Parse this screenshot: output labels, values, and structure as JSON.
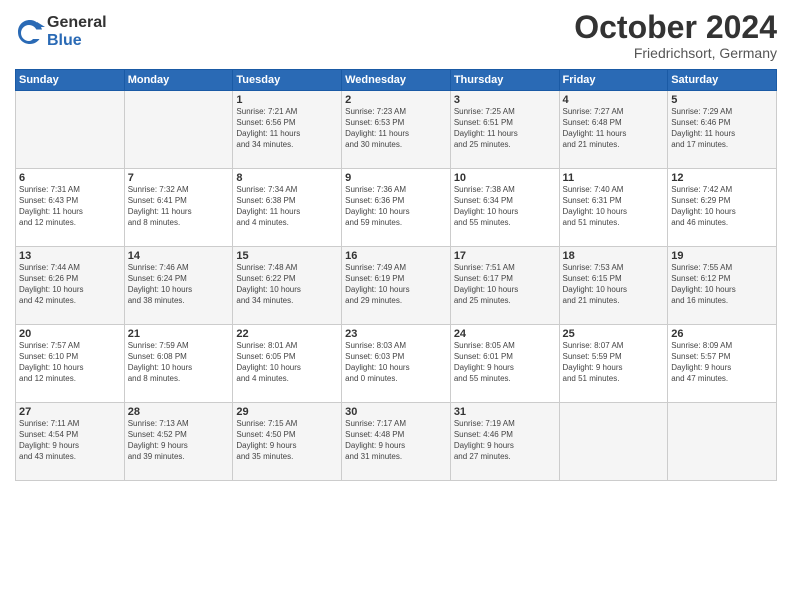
{
  "header": {
    "logo_general": "General",
    "logo_blue": "Blue",
    "title": "October 2024",
    "subtitle": "Friedrichsort, Germany"
  },
  "days_of_week": [
    "Sunday",
    "Monday",
    "Tuesday",
    "Wednesday",
    "Thursday",
    "Friday",
    "Saturday"
  ],
  "weeks": [
    [
      {
        "day": null
      },
      {
        "day": null
      },
      {
        "day": 1,
        "sunrise": "Sunrise: 7:21 AM",
        "sunset": "Sunset: 6:56 PM",
        "daylight": "Daylight: 11 hours and 34 minutes."
      },
      {
        "day": 2,
        "sunrise": "Sunrise: 7:23 AM",
        "sunset": "Sunset: 6:53 PM",
        "daylight": "Daylight: 11 hours and 30 minutes."
      },
      {
        "day": 3,
        "sunrise": "Sunrise: 7:25 AM",
        "sunset": "Sunset: 6:51 PM",
        "daylight": "Daylight: 11 hours and 25 minutes."
      },
      {
        "day": 4,
        "sunrise": "Sunrise: 7:27 AM",
        "sunset": "Sunset: 6:48 PM",
        "daylight": "Daylight: 11 hours and 21 minutes."
      },
      {
        "day": 5,
        "sunrise": "Sunrise: 7:29 AM",
        "sunset": "Sunset: 6:46 PM",
        "daylight": "Daylight: 11 hours and 17 minutes."
      }
    ],
    [
      {
        "day": 6,
        "sunrise": "Sunrise: 7:31 AM",
        "sunset": "Sunset: 6:43 PM",
        "daylight": "Daylight: 11 hours and 12 minutes."
      },
      {
        "day": 7,
        "sunrise": "Sunrise: 7:32 AM",
        "sunset": "Sunset: 6:41 PM",
        "daylight": "Daylight: 11 hours and 8 minutes."
      },
      {
        "day": 8,
        "sunrise": "Sunrise: 7:34 AM",
        "sunset": "Sunset: 6:38 PM",
        "daylight": "Daylight: 11 hours and 4 minutes."
      },
      {
        "day": 9,
        "sunrise": "Sunrise: 7:36 AM",
        "sunset": "Sunset: 6:36 PM",
        "daylight": "Daylight: 10 hours and 59 minutes."
      },
      {
        "day": 10,
        "sunrise": "Sunrise: 7:38 AM",
        "sunset": "Sunset: 6:34 PM",
        "daylight": "Daylight: 10 hours and 55 minutes."
      },
      {
        "day": 11,
        "sunrise": "Sunrise: 7:40 AM",
        "sunset": "Sunset: 6:31 PM",
        "daylight": "Daylight: 10 hours and 51 minutes."
      },
      {
        "day": 12,
        "sunrise": "Sunrise: 7:42 AM",
        "sunset": "Sunset: 6:29 PM",
        "daylight": "Daylight: 10 hours and 46 minutes."
      }
    ],
    [
      {
        "day": 13,
        "sunrise": "Sunrise: 7:44 AM",
        "sunset": "Sunset: 6:26 PM",
        "daylight": "Daylight: 10 hours and 42 minutes."
      },
      {
        "day": 14,
        "sunrise": "Sunrise: 7:46 AM",
        "sunset": "Sunset: 6:24 PM",
        "daylight": "Daylight: 10 hours and 38 minutes."
      },
      {
        "day": 15,
        "sunrise": "Sunrise: 7:48 AM",
        "sunset": "Sunset: 6:22 PM",
        "daylight": "Daylight: 10 hours and 34 minutes."
      },
      {
        "day": 16,
        "sunrise": "Sunrise: 7:49 AM",
        "sunset": "Sunset: 6:19 PM",
        "daylight": "Daylight: 10 hours and 29 minutes."
      },
      {
        "day": 17,
        "sunrise": "Sunrise: 7:51 AM",
        "sunset": "Sunset: 6:17 PM",
        "daylight": "Daylight: 10 hours and 25 minutes."
      },
      {
        "day": 18,
        "sunrise": "Sunrise: 7:53 AM",
        "sunset": "Sunset: 6:15 PM",
        "daylight": "Daylight: 10 hours and 21 minutes."
      },
      {
        "day": 19,
        "sunrise": "Sunrise: 7:55 AM",
        "sunset": "Sunset: 6:12 PM",
        "daylight": "Daylight: 10 hours and 16 minutes."
      }
    ],
    [
      {
        "day": 20,
        "sunrise": "Sunrise: 7:57 AM",
        "sunset": "Sunset: 6:10 PM",
        "daylight": "Daylight: 10 hours and 12 minutes."
      },
      {
        "day": 21,
        "sunrise": "Sunrise: 7:59 AM",
        "sunset": "Sunset: 6:08 PM",
        "daylight": "Daylight: 10 hours and 8 minutes."
      },
      {
        "day": 22,
        "sunrise": "Sunrise: 8:01 AM",
        "sunset": "Sunset: 6:05 PM",
        "daylight": "Daylight: 10 hours and 4 minutes."
      },
      {
        "day": 23,
        "sunrise": "Sunrise: 8:03 AM",
        "sunset": "Sunset: 6:03 PM",
        "daylight": "Daylight: 10 hours and 0 minutes."
      },
      {
        "day": 24,
        "sunrise": "Sunrise: 8:05 AM",
        "sunset": "Sunset: 6:01 PM",
        "daylight": "Daylight: 9 hours and 55 minutes."
      },
      {
        "day": 25,
        "sunrise": "Sunrise: 8:07 AM",
        "sunset": "Sunset: 5:59 PM",
        "daylight": "Daylight: 9 hours and 51 minutes."
      },
      {
        "day": 26,
        "sunrise": "Sunrise: 8:09 AM",
        "sunset": "Sunset: 5:57 PM",
        "daylight": "Daylight: 9 hours and 47 minutes."
      }
    ],
    [
      {
        "day": 27,
        "sunrise": "Sunrise: 7:11 AM",
        "sunset": "Sunset: 4:54 PM",
        "daylight": "Daylight: 9 hours and 43 minutes."
      },
      {
        "day": 28,
        "sunrise": "Sunrise: 7:13 AM",
        "sunset": "Sunset: 4:52 PM",
        "daylight": "Daylight: 9 hours and 39 minutes."
      },
      {
        "day": 29,
        "sunrise": "Sunrise: 7:15 AM",
        "sunset": "Sunset: 4:50 PM",
        "daylight": "Daylight: 9 hours and 35 minutes."
      },
      {
        "day": 30,
        "sunrise": "Sunrise: 7:17 AM",
        "sunset": "Sunset: 4:48 PM",
        "daylight": "Daylight: 9 hours and 31 minutes."
      },
      {
        "day": 31,
        "sunrise": "Sunrise: 7:19 AM",
        "sunset": "Sunset: 4:46 PM",
        "daylight": "Daylight: 9 hours and 27 minutes."
      },
      {
        "day": null
      },
      {
        "day": null
      }
    ]
  ]
}
